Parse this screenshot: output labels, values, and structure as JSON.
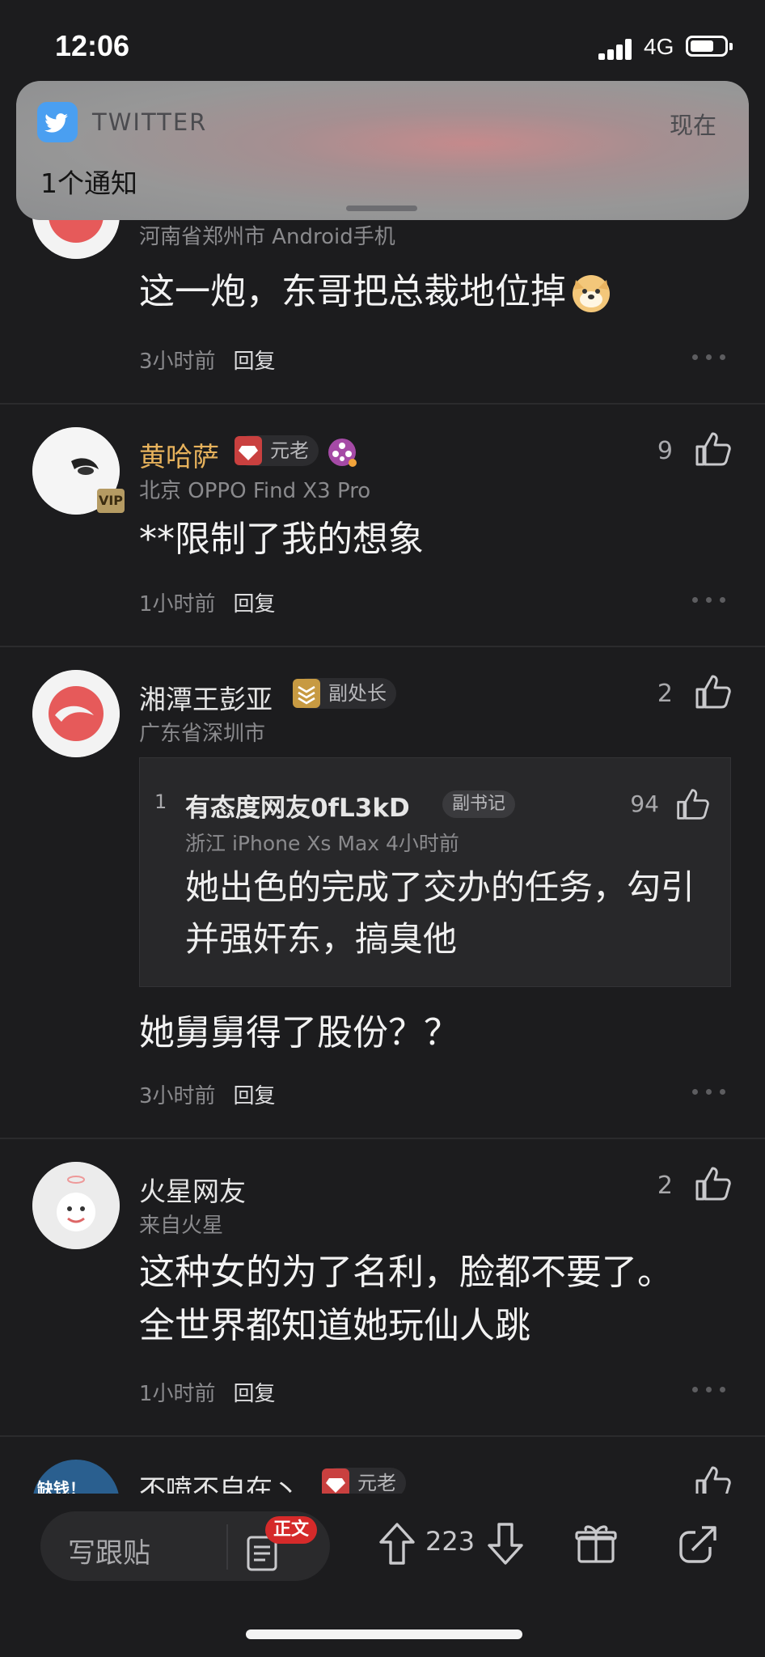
{
  "status_bar": {
    "time": "12:06",
    "network": "4G"
  },
  "notification": {
    "app": "TWITTER",
    "time": "现在",
    "body": "1个通知",
    "icon": "twitter-bird-icon"
  },
  "comments": [
    {
      "location": "河南省郑州市  Android手机",
      "text": "这一炮，东哥把总裁地位掉",
      "time": "3小时前",
      "reply": "回复"
    },
    {
      "username": "黄哈萨",
      "badge": "元老",
      "vip": "VIP",
      "likes": "9",
      "location": "北京  OPPO Find X3 Pro",
      "text": "**限制了我的想象",
      "time": "1小时前",
      "reply": "回复"
    },
    {
      "username": "湘潭王彭亚",
      "badge": "副处长",
      "likes": "2",
      "location": "广东省深圳市",
      "quote": {
        "index": "1",
        "username": "有态度网友0fL3kD",
        "badge": "副书记",
        "likes": "94",
        "location": "浙江  iPhone Xs Max  4小时前",
        "text": "她出色的完成了交办的任务，勾引并强奸东，搞臭他"
      },
      "text": "她舅舅得了股份？？",
      "time": "3小时前",
      "reply": "回复"
    },
    {
      "username": "火星网友",
      "likes": "2",
      "location": "来自火星",
      "text": "这种女的为了名利，脸都不要了。全世界都知道她玩仙人跳",
      "time": "1小时前",
      "reply": "回复"
    },
    {
      "username": "不喷不自在丶",
      "badge": "元老",
      "avatar_text": "缺钱！"
    }
  ],
  "bottom_bar": {
    "write_placeholder": "写跟贴",
    "article_badge": "正文",
    "vote_count": "223"
  },
  "colors": {
    "accent_gold": "#e7b25c",
    "badge_red": "#d52a2a",
    "twitter_blue": "#4a9ff1"
  }
}
